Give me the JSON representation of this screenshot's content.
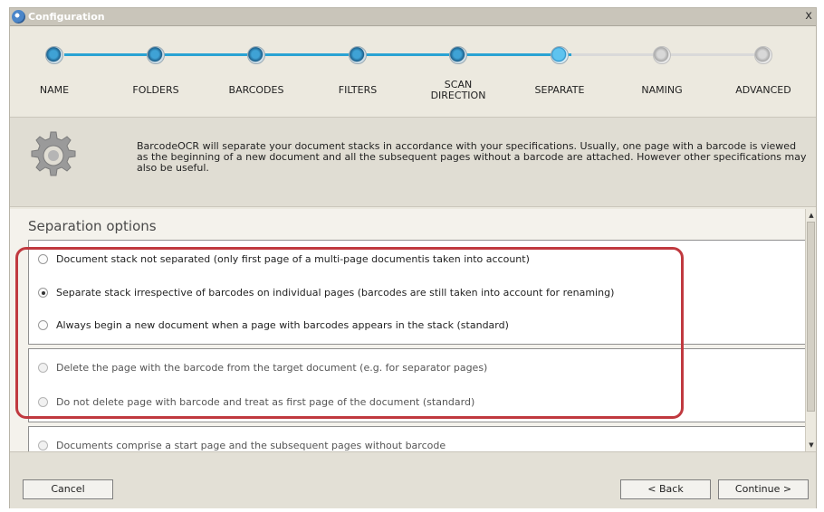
{
  "window": {
    "title": "Configuration",
    "close_label": "x"
  },
  "steps": [
    {
      "label": "NAME",
      "state": "done"
    },
    {
      "label": "FOLDERS",
      "state": "done"
    },
    {
      "label": "BARCODES",
      "state": "done"
    },
    {
      "label": "FILTERS",
      "state": "done"
    },
    {
      "label_line1": "SCAN",
      "label_line2": "DIRECTION",
      "state": "done"
    },
    {
      "label": "SEPARATE",
      "state": "current"
    },
    {
      "label": "NAMING",
      "state": "pending"
    },
    {
      "label": "ADVANCED",
      "state": "pending"
    }
  ],
  "info": {
    "icon": "gear-icon",
    "text": "BarcodeOCR will separate your document stacks in accordance with your specifications. Usually, one page with a barcode is viewed as the beginning of a new document and all the subsequent pages without a barcode are attached. However other specifications may also be useful."
  },
  "section": {
    "title": "Separation options",
    "group1": [
      {
        "label": "Document stack not separated (only first page of a multi-page documentis taken into account)",
        "selected": false
      },
      {
        "label": "Separate stack irrespective of barcodes on individual pages (barcodes are still taken into account for renaming)",
        "selected": true
      },
      {
        "label": "Always begin a new document when a page with barcodes appears in the stack (standard)",
        "selected": false
      }
    ],
    "group2": [
      {
        "label": "Delete the page with the barcode from the target document (e.g. for separator pages)",
        "selected": false,
        "enabled": false
      },
      {
        "label": "Do not delete page with barcode and treat as first page of the document (standard)",
        "selected": false,
        "enabled": false
      }
    ],
    "group3": [
      {
        "label": "Documents comprise a start page and the subsequent pages without barcode",
        "selected": false,
        "enabled": false
      }
    ]
  },
  "buttons": {
    "cancel": "Cancel",
    "back": "< Back",
    "continue": "Continue >"
  },
  "colors": {
    "highlight": "#c0393f",
    "step_active": "#2a8fc6",
    "step_done_line": "#2aa3d3",
    "step_pending_line": "#d9d9d9"
  }
}
